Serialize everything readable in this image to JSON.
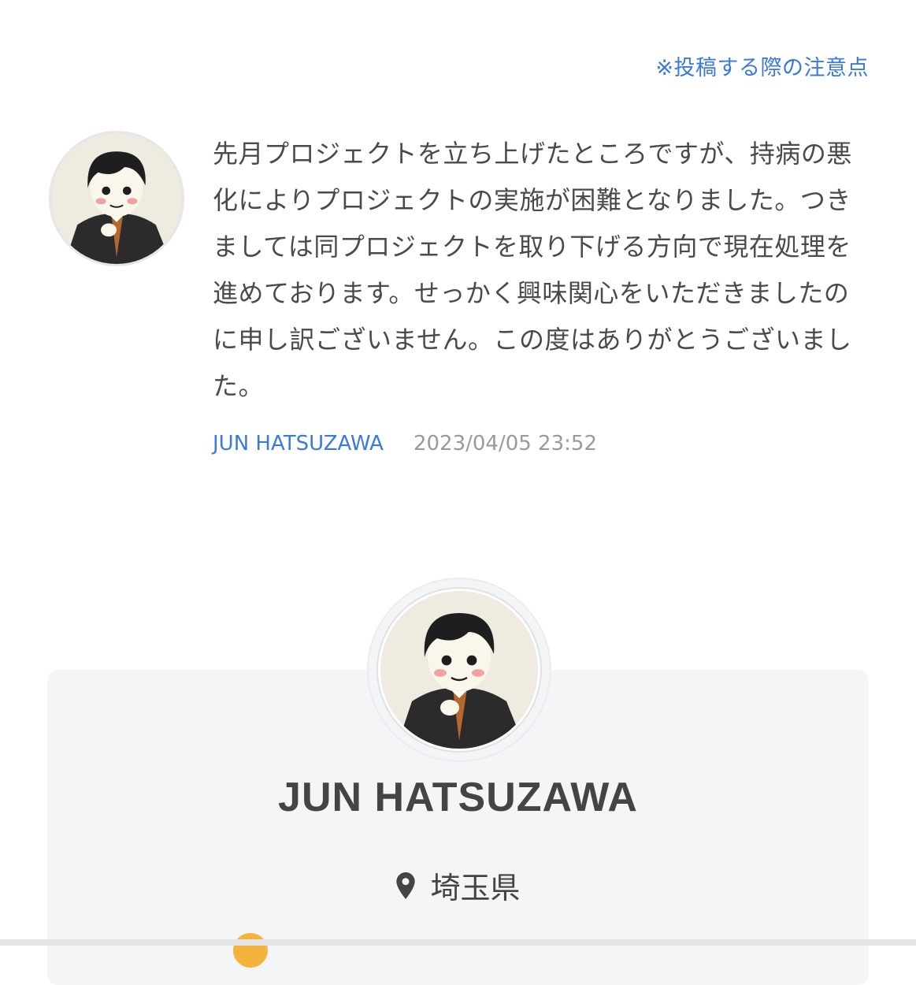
{
  "header": {
    "notice_link": "※投稿する際の注意点"
  },
  "comment": {
    "text": "先月プロジェクトを立ち上げたところですが、持病の悪化によりプロジェクトの実施が困難となりました。つきましては同プロジェクトを取り下げる方向で現在処理を進めております。せっかく興味関心をいただきましたのに申し訳ございません。この度はありがとうございました。",
    "author": "JUN HATSUZAWA",
    "timestamp": "2023/04/05 23:52",
    "avatar_icon": "user-avatar-illustration"
  },
  "profile": {
    "name": "JUN HATSUZAWA",
    "location": "埼玉県",
    "location_icon": "map-pin-icon",
    "avatar_icon": "user-avatar-illustration"
  },
  "colors": {
    "link": "#3b7ad9",
    "card_bg": "#f4f5f7",
    "text": "#4a4a4a",
    "muted": "#9a9a9a",
    "accent": "#f3b33c"
  }
}
